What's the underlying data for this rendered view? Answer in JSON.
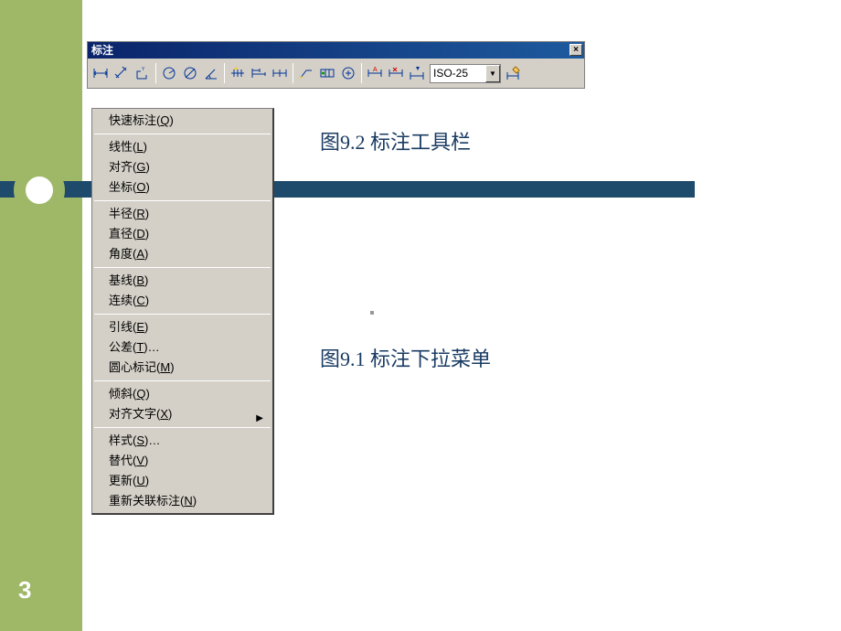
{
  "pageNumber": "3",
  "toolbar": {
    "title": "标注",
    "closeLabel": "×",
    "dropdownValue": "ISO-25",
    "dropdownArrow": "▼"
  },
  "captions": {
    "fig92": "图9.2  标注工具栏",
    "fig91": "图9.1  标注下拉菜单"
  },
  "menu": {
    "items": [
      {
        "label": "快速标注(Q)",
        "hasArrow": false
      },
      {
        "sep": true
      },
      {
        "label": "线性(L)",
        "hasArrow": false
      },
      {
        "label": "对齐(G)",
        "hasArrow": false
      },
      {
        "label": "坐标(O)",
        "hasArrow": false
      },
      {
        "sep": true
      },
      {
        "label": "半径(R)",
        "hasArrow": false
      },
      {
        "label": "直径(D)",
        "hasArrow": false
      },
      {
        "label": "角度(A)",
        "hasArrow": false
      },
      {
        "sep": true
      },
      {
        "label": "基线(B)",
        "hasArrow": false
      },
      {
        "label": "连续(C)",
        "hasArrow": false
      },
      {
        "sep": true
      },
      {
        "label": "引线(E)",
        "hasArrow": false
      },
      {
        "label": "公差(T)…",
        "hasArrow": false
      },
      {
        "label": "圆心标记(M)",
        "hasArrow": false
      },
      {
        "sep": true
      },
      {
        "label": "倾斜(Q)",
        "hasArrow": false
      },
      {
        "label": "对齐文字(X)",
        "hasArrow": true
      },
      {
        "sep": true
      },
      {
        "label": "样式(S)…",
        "hasArrow": false
      },
      {
        "label": "替代(V)",
        "hasArrow": false
      },
      {
        "label": "更新(U)",
        "hasArrow": false
      },
      {
        "label": "重新关联标注(N)",
        "hasArrow": false
      }
    ],
    "submenuArrow": "▶"
  }
}
